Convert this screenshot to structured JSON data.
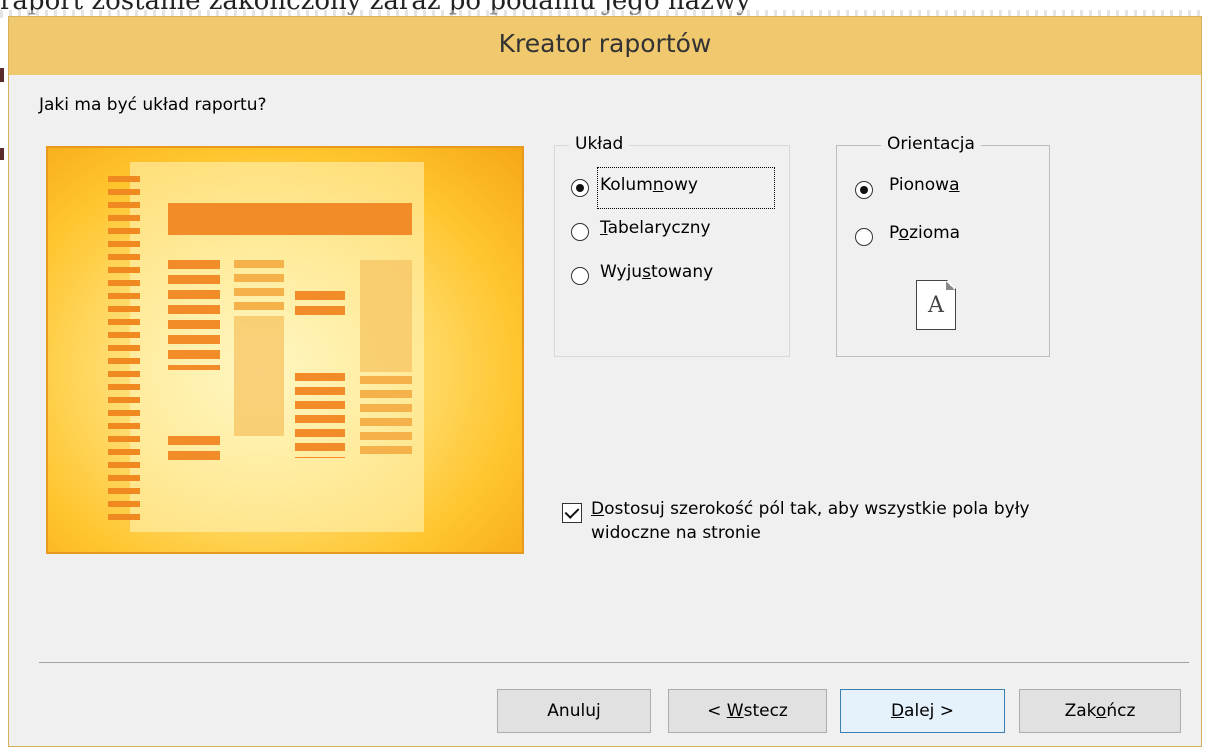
{
  "background": {
    "partial_text": "raport zostanie zakończony zaraz po podaniu jego nazwy"
  },
  "dialog": {
    "title": "Kreator raportów",
    "question": "Jaki ma być układ raportu?"
  },
  "layout_group": {
    "label": "Układ",
    "options": [
      {
        "pre": "Kolum",
        "key": "n",
        "post": "owy",
        "selected": true
      },
      {
        "pre": "",
        "key": "T",
        "post": "abelaryczny",
        "selected": false
      },
      {
        "pre": "Wyju",
        "key": "s",
        "post": "towany",
        "selected": false
      }
    ]
  },
  "orientation_group": {
    "label": "Orientacja",
    "options": [
      {
        "pre": "Pionow",
        "key": "a",
        "post": "",
        "selected": true
      },
      {
        "pre": "P",
        "key": "o",
        "post": "zioma",
        "selected": false
      }
    ],
    "page_icon_letter": "A"
  },
  "adjust_width": {
    "checked": true,
    "line1_key": "D",
    "line1_rest": "ostosuj szerokość pól tak, aby wszystkie pola były",
    "line2": "widoczne na stronie"
  },
  "buttons": {
    "cancel": "Anuluj",
    "back_pre": "< ",
    "back_key": "W",
    "back_post": "stecz",
    "next_key": "D",
    "next_post": "alej >",
    "finish_pre": "Zak",
    "finish_key": "o",
    "finish_post": "ńcz"
  },
  "colors": {
    "titlebar": "#f0c86e",
    "preview_border": "#e89a1e",
    "preview_bars": "#f28c28",
    "default_button_border": "#3c7fb1"
  }
}
